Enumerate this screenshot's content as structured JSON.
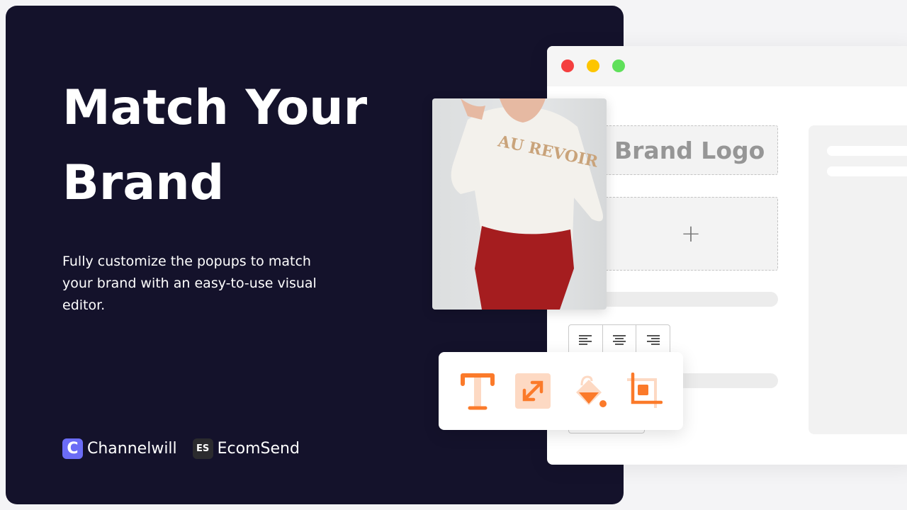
{
  "hero": {
    "title_line1": "Match Your",
    "title_line2": "Brand",
    "description": "Fully customize the popups to match your brand with an easy-to-use visual editor."
  },
  "brands": [
    {
      "name": "Channelwill",
      "logo_letter": "C",
      "color": "#6b6cf6"
    },
    {
      "name": "EcomSend",
      "logo_letter": "ES",
      "color": "#2b2b2e"
    }
  ],
  "editor": {
    "window_controls": [
      "close",
      "minimize",
      "maximize"
    ],
    "brand_logo_placeholder": "Brand Logo",
    "add_icon": "+",
    "align_buttons": [
      "align-left-icon",
      "align-center-icon",
      "align-right-icon"
    ],
    "tools": [
      "text-icon",
      "resize-icon",
      "paint-bucket-icon",
      "crop-icon"
    ],
    "accent_color": "#fb7a2a",
    "photo_shirt_text": "AU REVOIR"
  },
  "colors": {
    "panel": "#14122b",
    "close": "#f43f3f",
    "minimize": "#fdc500",
    "maximize": "#5fe05a"
  }
}
